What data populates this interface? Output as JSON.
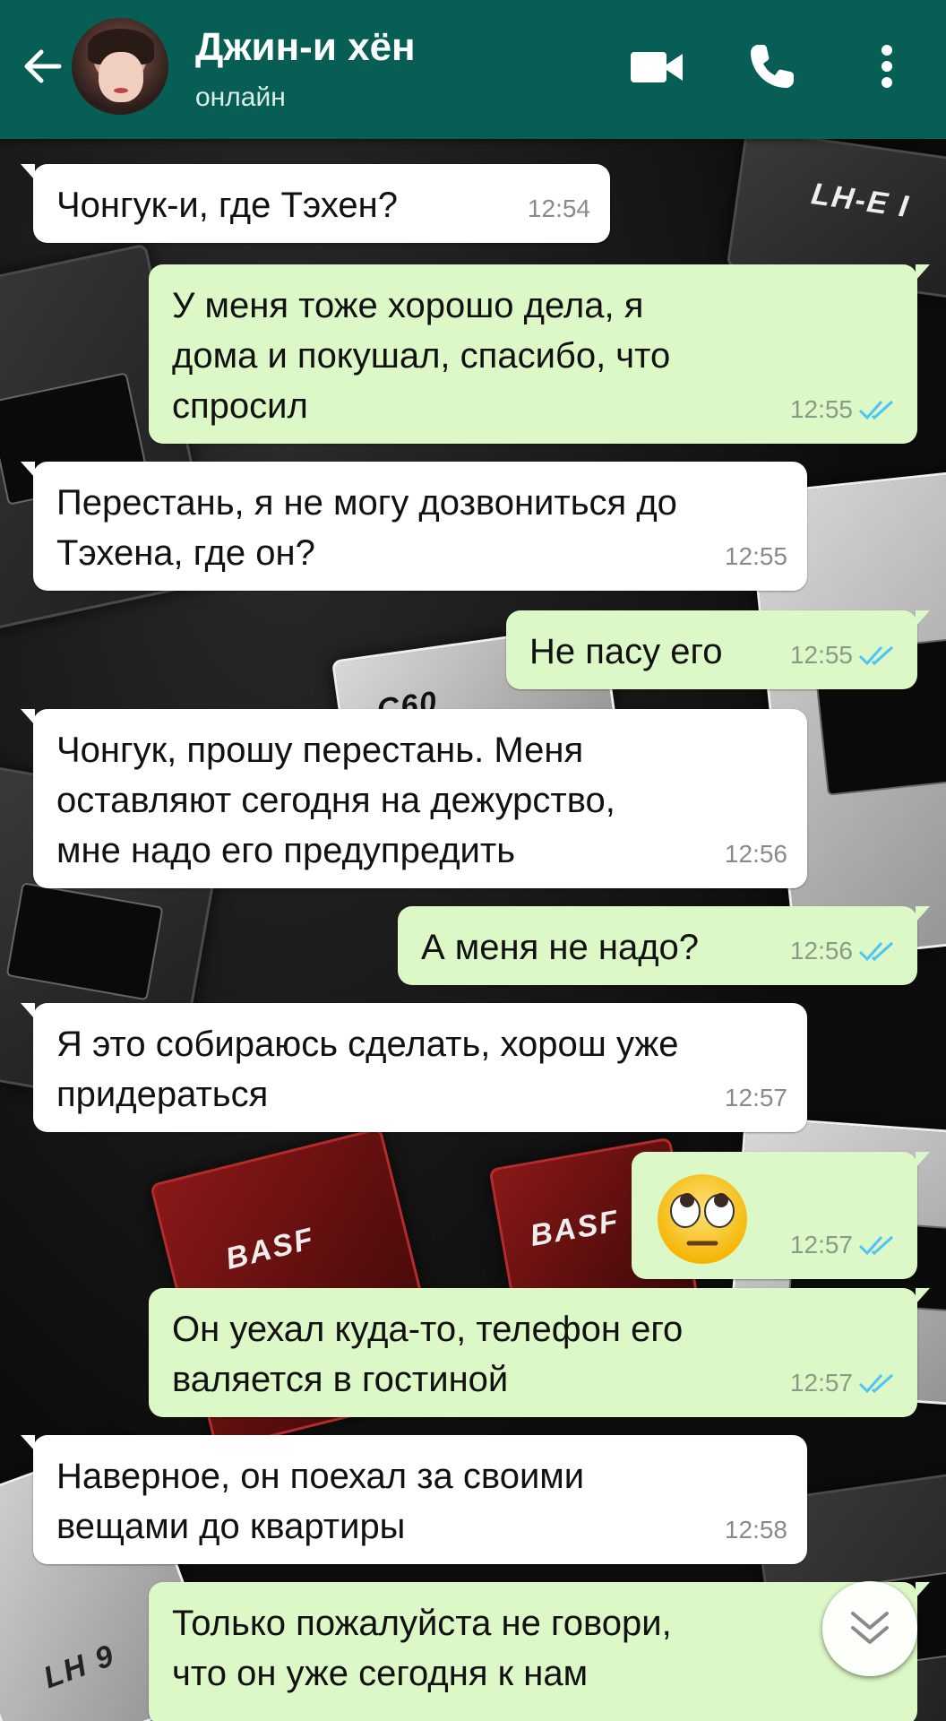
{
  "header": {
    "contact_name": "Джин-и хён",
    "status": "онлайн",
    "background_color": "#075e54",
    "icons": [
      "back-arrow-icon",
      "video-call-icon",
      "phone-icon",
      "more-vert-icon"
    ]
  },
  "wallpaper": {
    "labels": [
      "LH-E I",
      "C60",
      "BASF",
      "BASF",
      "LH 9"
    ]
  },
  "messages": [
    {
      "dir": "in",
      "text": "Чонгук-и, где Тэхен?",
      "time": "12:54"
    },
    {
      "dir": "out",
      "text": "У меня тоже хорошо дела, я\nдома и покушал, спасибо, что\nспросил",
      "time": "12:55",
      "status": "read"
    },
    {
      "dir": "in",
      "text": "Перестань, я не могу дозвониться до\nТэхена, где он?",
      "time": "12:55"
    },
    {
      "dir": "out",
      "text": "Не пасу его",
      "time": "12:55",
      "status": "read"
    },
    {
      "dir": "in",
      "text": "Чонгук, прошу перестань. Меня\nоставляют сегодня на дежурство,\nмне надо его предупредить",
      "time": "12:56"
    },
    {
      "dir": "out",
      "text": "А меня не надо?",
      "time": "12:56",
      "status": "read"
    },
    {
      "dir": "in",
      "text": "Я это собираюсь сделать, хорош уже\nпридераться",
      "time": "12:57"
    },
    {
      "dir": "out",
      "emoji": "face-with-rolling-eyes",
      "time": "12:57",
      "status": "read"
    },
    {
      "dir": "out",
      "text": "Он уехал куда-то, телефон его\nваляется в гостиной",
      "time": "12:57",
      "status": "read"
    },
    {
      "dir": "in",
      "text": "Наверное, он поехал за своими\nвещами до квартиры",
      "time": "12:58"
    },
    {
      "dir": "out",
      "text": "Только пожалуйста не говори,\nчто он уже сегодня к нам",
      "time": "",
      "status": ""
    }
  ],
  "colors": {
    "incoming_bubble": "#ffffff",
    "outgoing_bubble": "#dcf8c6",
    "read_ticks": "#4fc3f7"
  }
}
